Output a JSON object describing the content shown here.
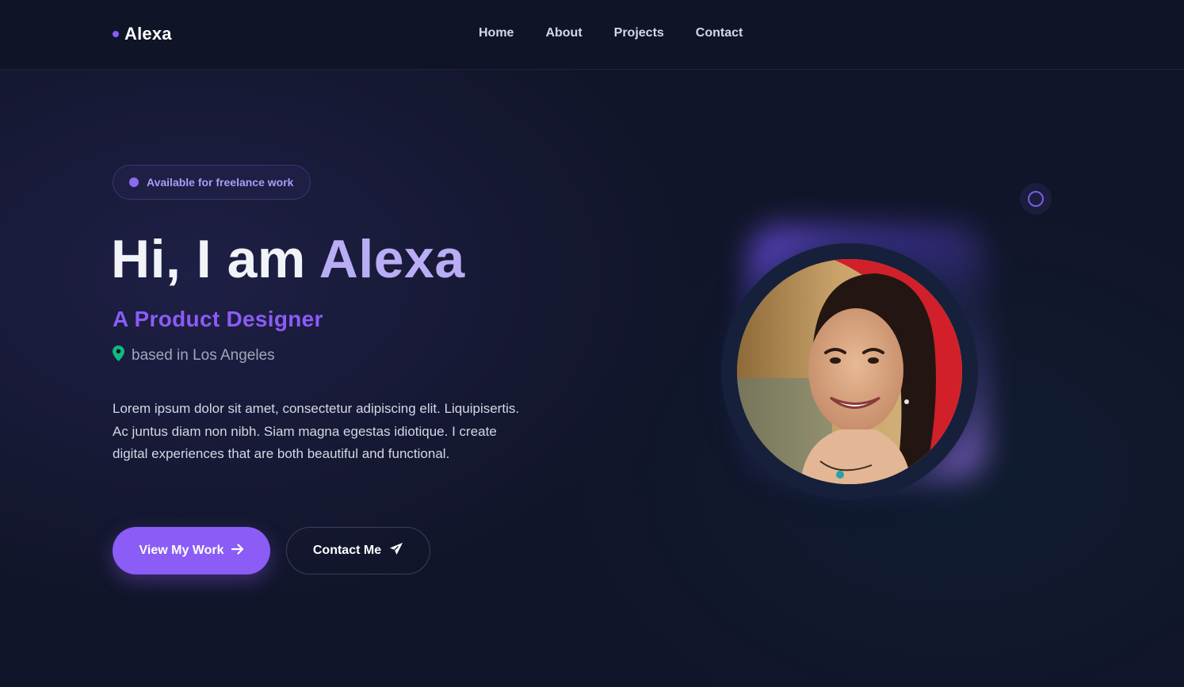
{
  "header": {
    "logo": "Alexa",
    "nav": [
      "Home",
      "About",
      "Projects",
      "Contact"
    ]
  },
  "hero": {
    "badge": "Available for freelance work",
    "greeting": "Hi, I am",
    "name": "Alexa",
    "role": "A Product Designer",
    "location": "based in Los Angeles",
    "description": "Lorem ipsum dolor sit amet, consectetur adipiscing elit. Liquipisertis. Ac juntus diam non nibh. Siam magna egestas idiotique. I create digital experiences that are both beautiful and functional.",
    "primary_button": "View My Work",
    "secondary_button": "Contact Me"
  },
  "icons": {
    "location": "map-pin-icon",
    "primary_button": "arrow-right-icon",
    "secondary_button": "paper-plane-icon"
  },
  "colors": {
    "accent": "#8b5cf6",
    "background": "#111529",
    "location_pin": "#10b981"
  }
}
